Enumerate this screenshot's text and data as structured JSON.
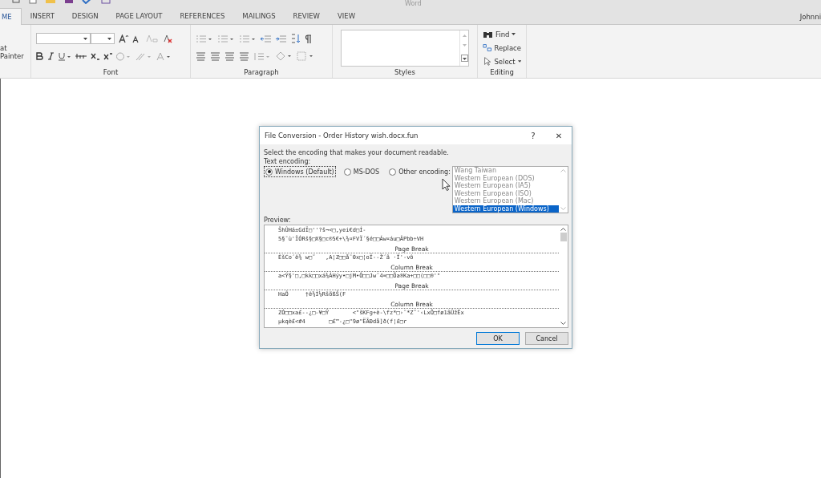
{
  "app_title": "Word",
  "user": "Johnni",
  "tabs": [
    {
      "label": "ME",
      "selected": true
    },
    {
      "label": "INSERT",
      "selected": false
    },
    {
      "label": "DESIGN",
      "selected": false
    },
    {
      "label": "PAGE LAYOUT",
      "selected": false
    },
    {
      "label": "REFERENCES",
      "selected": false
    },
    {
      "label": "MAILINGS",
      "selected": false
    },
    {
      "label": "REVIEW",
      "selected": false
    },
    {
      "label": "VIEW",
      "selected": false
    }
  ],
  "clipboard": {
    "format_painter": "at Painter"
  },
  "groups": [
    "Font",
    "Paragraph",
    "Styles",
    "Editing"
  ],
  "editing": [
    {
      "label": "Find",
      "dropdown": true
    },
    {
      "label": "Replace",
      "dropdown": false
    },
    {
      "label": "Select",
      "dropdown": true
    }
  ],
  "dialog": {
    "title": "File Conversion - Order History wish.docx.fun",
    "help": "?",
    "close": "✕",
    "instruction": "Select the encoding that makes your document readable.",
    "encoding_label": "Text encoding:",
    "options": [
      {
        "label": "Windows (Default)",
        "selected": true
      },
      {
        "label": "MS-DOS",
        "selected": false
      },
      {
        "label": "Other encoding:",
        "selected": false
      }
    ],
    "encodings": [
      {
        "label": "Wang Taiwan",
        "selected": false
      },
      {
        "label": "Western European (DOS)",
        "selected": false
      },
      {
        "label": "Western European (IA5)",
        "selected": false
      },
      {
        "label": "Western European (ISO)",
        "selected": false
      },
      {
        "label": "Western European (Mac)",
        "selected": false
      },
      {
        "label": "Western European (Windows)",
        "selected": true
      }
    ],
    "preview_label": "Preview:",
    "preview": [
      {
        "kind": "text",
        "text": "ŠhÛHá±GdÏ□''?š¬<□,yei€d□Í-"
      },
      {
        "kind": "text",
        "text": "5§¯ù'ÏÓRš§□X§□c®5€+\\¾¤FVÏ´§é□□Áw¤áu□ÂPbb÷VH"
      },
      {
        "kind": "break",
        "text": "Page Break"
      },
      {
        "kind": "text",
        "text": "ÈšCo´ê¾ w□˜   ,A¦Z□□å¯0x□¦oÏ--Ž´ã ·Î'-vô"
      },
      {
        "kind": "break",
        "text": "Column Break"
      },
      {
        "kind": "text",
        "text": "a<Ý§'□,□kk□□xá¾ÁHýy•□jM•Ô□□Jw¯4=□□Õa®Ka+□□(□□®'\""
      },
      {
        "kind": "break",
        "text": "Page Break"
      },
      {
        "kind": "text",
        "text": "HaÔ     †ê¾Í¼RšõßŠ(F"
      },
      {
        "kind": "break",
        "text": "Column Break"
      },
      {
        "kind": "text",
        "text": "ZÓ□□xa£--¿□-¥□Ÿ       <\"šKFg+è-\\fz*□›¨*Z˜'‹LxÕ□fø1ãÛžÊx"
      },
      {
        "kind": "text",
        "text": "µkqè£<#4       □£™-¿□\"9ø\"ËÃÐdå]ð(f¦£□r"
      }
    ],
    "ok": "OK",
    "cancel": "Cancel"
  }
}
